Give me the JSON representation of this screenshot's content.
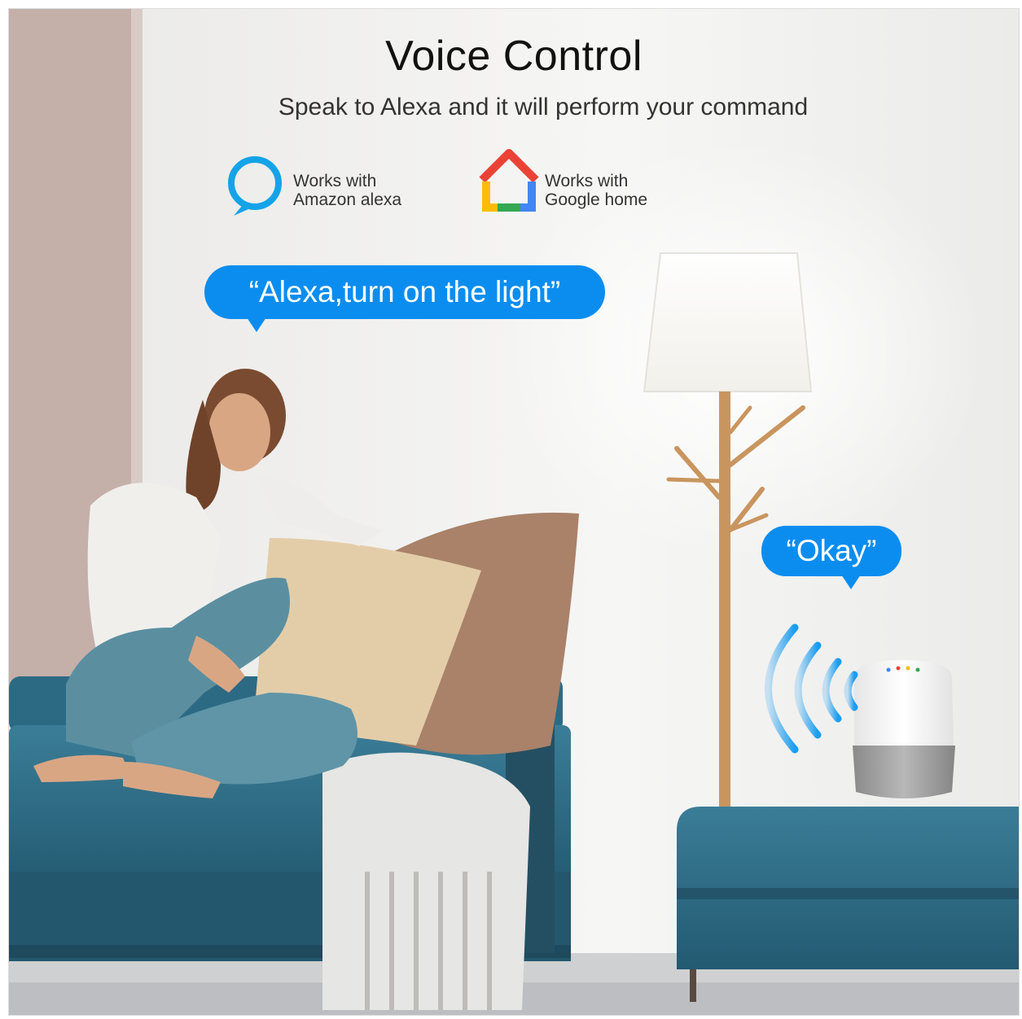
{
  "header": {
    "title": "Voice Control",
    "subtitle": "Speak to Alexa and it will perform your command"
  },
  "badges": [
    {
      "icon": "alexa-ring-icon",
      "line1": "Works with",
      "line2": "Amazon alexa"
    },
    {
      "icon": "google-home-icon",
      "line1": "Works with",
      "line2": "Google home"
    }
  ],
  "bubbles": {
    "user_command": "“Alexa,turn on the light”",
    "assistant_reply": "“Okay”"
  },
  "colors": {
    "bubble_blue": "#0b8df0",
    "alexa_blue": "#14a3e8",
    "sofa_teal": "#2f6b83",
    "google_red": "#ea4335",
    "google_yellow": "#fbbc05",
    "google_green": "#34a853",
    "google_blue": "#4285f4"
  }
}
